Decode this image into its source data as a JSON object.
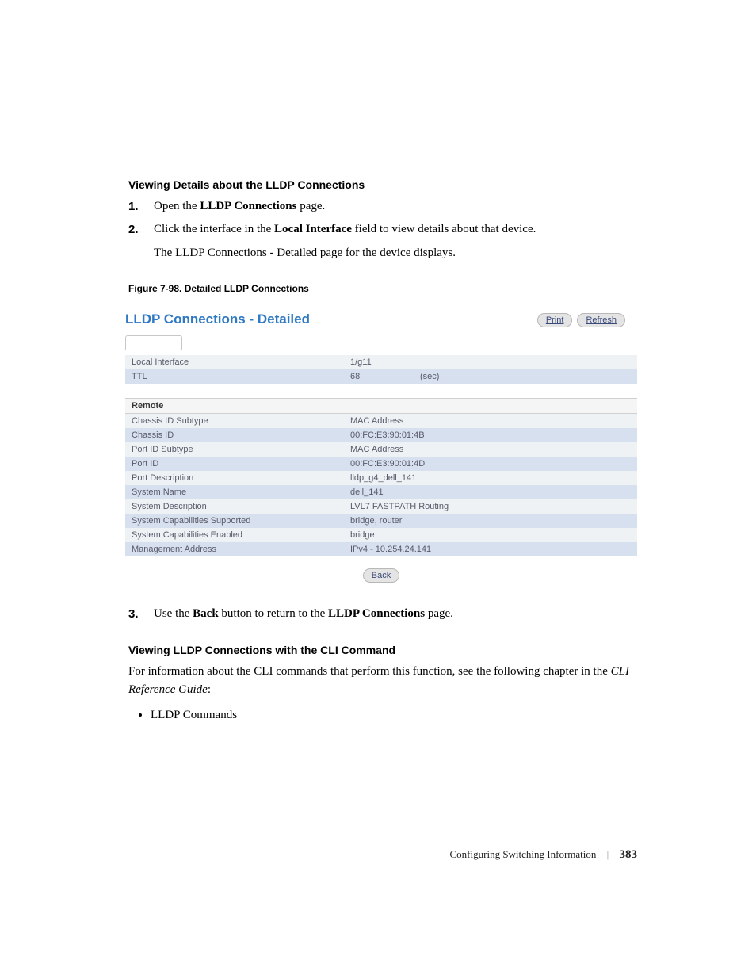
{
  "headings": {
    "h1": "Viewing Details about the LLDP Connections",
    "h2": "Viewing LLDP Connections with the CLI Command"
  },
  "step1": {
    "num": "1.",
    "pre": "Open the ",
    "bold": "LLDP Connections",
    "post": " page."
  },
  "step2": {
    "num": "2.",
    "pre": "Click the interface in the ",
    "bold": "Local Interface",
    "post": " field to view details about that device."
  },
  "step2b": {
    "pre": "The ",
    "bold": "LLDP Connections - Detailed",
    "post": " page for the device displays."
  },
  "figcap": "Figure 7-98.    Detailed LLDP Connections",
  "panel": {
    "title": "LLDP Connections - Detailed",
    "print": "Print",
    "refresh": "Refresh",
    "back": "Back"
  },
  "top_rows": [
    {
      "label": "Local Interface",
      "v1": "1/g11",
      "v2": ""
    },
    {
      "label": "TTL",
      "v1": "68",
      "v2": "(sec)"
    }
  ],
  "remote_header": "Remote",
  "remote_rows": [
    {
      "label": "Chassis ID Subtype",
      "value": "MAC Address"
    },
    {
      "label": "Chassis ID",
      "value": "00:FC:E3:90:01:4B"
    },
    {
      "label": "Port ID Subtype",
      "value": "MAC Address"
    },
    {
      "label": "Port ID",
      "value": "00:FC:E3:90:01:4D"
    },
    {
      "label": "Port Description",
      "value": "lldp_g4_dell_141"
    },
    {
      "label": "System Name",
      "value": "dell_141"
    },
    {
      "label": "System Description",
      "value": "LVL7 FASTPATH Routing"
    },
    {
      "label": "System Capabilities Supported",
      "value": "bridge, router"
    },
    {
      "label": "System Capabilities Enabled",
      "value": "bridge"
    },
    {
      "label": "Management Address",
      "value": "IPv4 - 10.254.24.141"
    }
  ],
  "step3": {
    "num": "3.",
    "pre": "Use the ",
    "bold1": "Back",
    "mid": " button to return to the ",
    "bold2": "LLDP Connections",
    "post": " page."
  },
  "para": {
    "pre": "For information about the CLI commands that perform this function, see the following chapter in the ",
    "italic": "CLI Reference Guide",
    "post": ":"
  },
  "bullet1": "LLDP Commands",
  "footer": {
    "text": "Configuring Switching Information",
    "page": "383"
  }
}
